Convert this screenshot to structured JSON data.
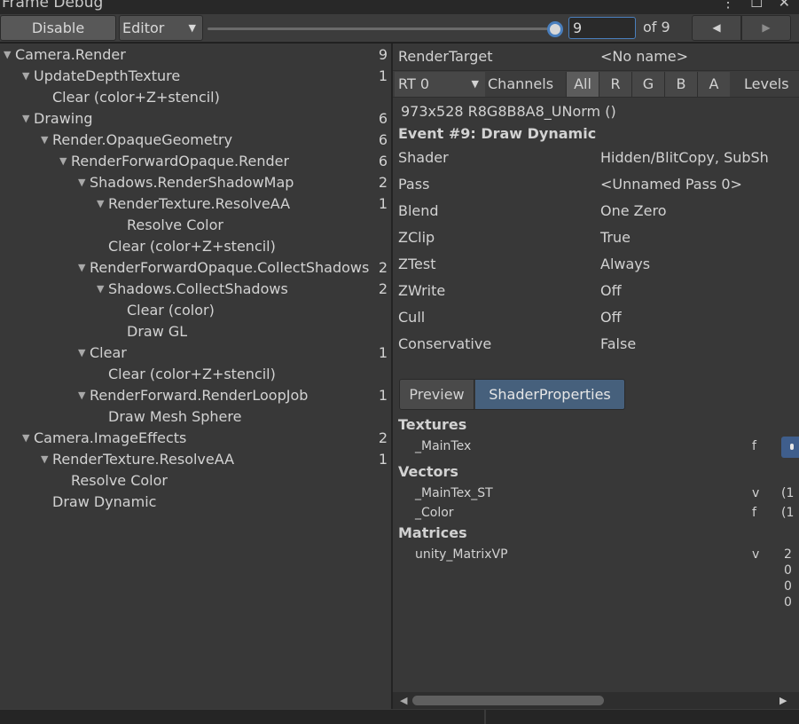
{
  "window": {
    "title": "Frame Debug"
  },
  "toolbar": {
    "disable_label": "Disable",
    "target_dropdown": "Editor",
    "frame_value": "9",
    "of_label": "of 9",
    "slider_fraction": 1.0
  },
  "tree": [
    {
      "label": "Camera.Render",
      "count": "9",
      "depth": 0,
      "expanded": true
    },
    {
      "label": "UpdateDepthTexture",
      "count": "1",
      "depth": 1,
      "expanded": true
    },
    {
      "label": "Clear (color+Z+stencil)",
      "count": "",
      "depth": 2,
      "expanded": null
    },
    {
      "label": "Drawing",
      "count": "6",
      "depth": 1,
      "expanded": true
    },
    {
      "label": "Render.OpaqueGeometry",
      "count": "6",
      "depth": 2,
      "expanded": true
    },
    {
      "label": "RenderForwardOpaque.Render",
      "count": "6",
      "depth": 3,
      "expanded": true
    },
    {
      "label": "Shadows.RenderShadowMap",
      "count": "2",
      "depth": 4,
      "expanded": true
    },
    {
      "label": "RenderTexture.ResolveAA",
      "count": "1",
      "depth": 5,
      "expanded": true
    },
    {
      "label": "Resolve Color",
      "count": "",
      "depth": 6,
      "expanded": null
    },
    {
      "label": "Clear (color+Z+stencil)",
      "count": "",
      "depth": 5,
      "expanded": null
    },
    {
      "label": "RenderForwardOpaque.CollectShadows",
      "count": "2",
      "depth": 4,
      "expanded": true
    },
    {
      "label": "Shadows.CollectShadows",
      "count": "2",
      "depth": 5,
      "expanded": true
    },
    {
      "label": "Clear (color)",
      "count": "",
      "depth": 6,
      "expanded": null
    },
    {
      "label": "Draw GL",
      "count": "",
      "depth": 6,
      "expanded": null
    },
    {
      "label": "Clear",
      "count": "1",
      "depth": 4,
      "expanded": true
    },
    {
      "label": "Clear (color+Z+stencil)",
      "count": "",
      "depth": 5,
      "expanded": null
    },
    {
      "label": "RenderForward.RenderLoopJob",
      "count": "1",
      "depth": 4,
      "expanded": true
    },
    {
      "label": "Draw Mesh Sphere",
      "count": "",
      "depth": 5,
      "expanded": null
    },
    {
      "label": "Camera.ImageEffects",
      "count": "2",
      "depth": 1,
      "expanded": true
    },
    {
      "label": "RenderTexture.ResolveAA",
      "count": "1",
      "depth": 2,
      "expanded": true
    },
    {
      "label": "Resolve Color",
      "count": "",
      "depth": 3,
      "expanded": null
    },
    {
      "label": "Draw Dynamic",
      "count": "",
      "depth": 2,
      "expanded": null
    }
  ],
  "details": {
    "render_target_label": "RenderTarget",
    "render_target_value": "<No name>",
    "rt_dropdown": "RT 0",
    "channels_label": "Channels",
    "channel_buttons": [
      "All",
      "R",
      "G",
      "B",
      "A"
    ],
    "levels_label": "Levels",
    "format_line": "973x528 R8G8B8A8_UNorm ()",
    "event_title": "Event #9: Draw Dynamic",
    "properties": [
      {
        "key": "Shader",
        "value": "Hidden/BlitCopy, SubSh"
      },
      {
        "key": "Pass",
        "value": "<Unnamed Pass 0>"
      },
      {
        "key": "Blend",
        "value": "One Zero"
      },
      {
        "key": "ZClip",
        "value": "True"
      },
      {
        "key": "ZTest",
        "value": "Always"
      },
      {
        "key": "ZWrite",
        "value": "Off"
      },
      {
        "key": "Cull",
        "value": "Off"
      },
      {
        "key": "Conservative",
        "value": "False"
      }
    ],
    "tabs": {
      "preview": "Preview",
      "shader_properties": "ShaderProperties"
    },
    "textures_heading": "Textures",
    "textures": [
      {
        "name": "_MainTex",
        "type": "f"
      }
    ],
    "vectors_heading": "Vectors",
    "vectors": [
      {
        "name": "_MainTex_ST",
        "type": "v",
        "value": "(1"
      },
      {
        "name": "_Color",
        "type": "f",
        "value": "(1"
      }
    ],
    "matrices_heading": "Matrices",
    "matrices": [
      {
        "name": "unity_MatrixVP",
        "type": "v"
      }
    ],
    "matrix_values": [
      "2",
      "0",
      "0",
      "0"
    ]
  }
}
